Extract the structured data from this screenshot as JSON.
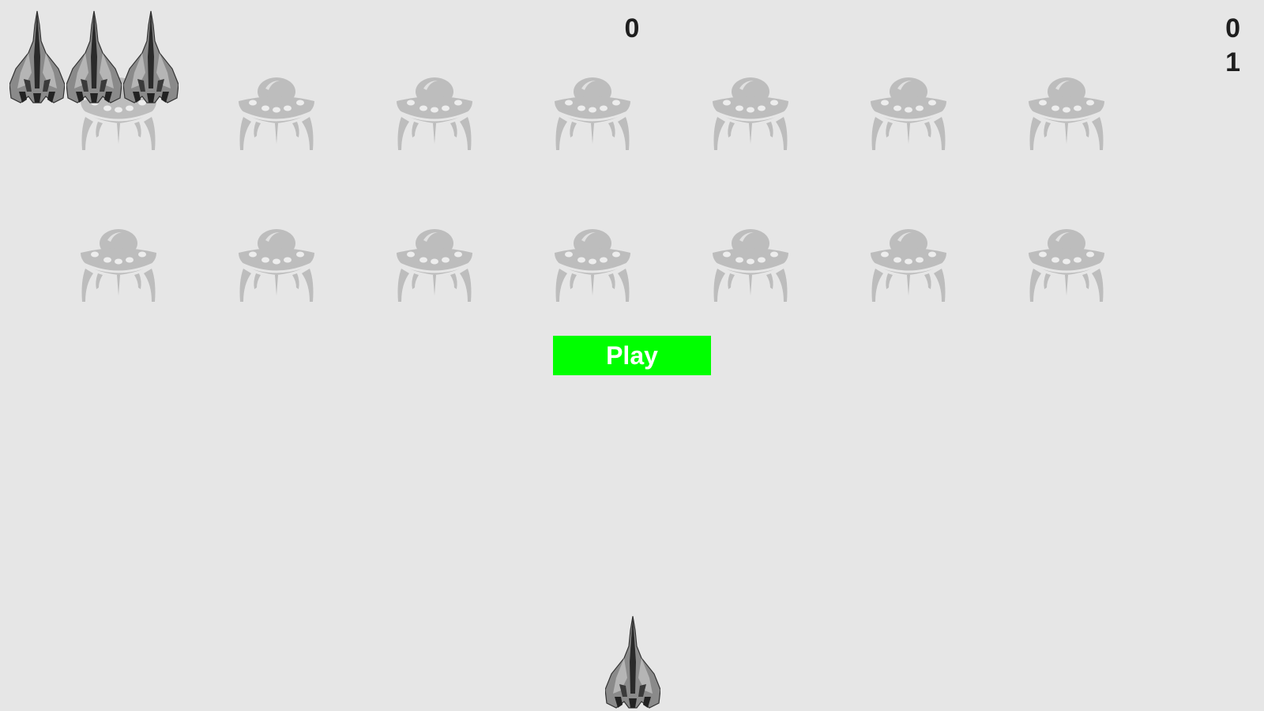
{
  "hud": {
    "score": "0",
    "high_score": "0",
    "level": "1"
  },
  "lives": {
    "remaining": 3,
    "icon": "ship-icon"
  },
  "fleet": {
    "rows": 2,
    "columns": 7,
    "icon": "alien-ufo-icon",
    "alien_color": "#bdbdbd"
  },
  "play_button": {
    "label": "Play",
    "color": "#00ff00",
    "text_color": "#ffffff"
  },
  "player": {
    "icon": "ship-icon"
  },
  "colors": {
    "background": "#e6e6e6",
    "text": "#1e1e1e"
  }
}
